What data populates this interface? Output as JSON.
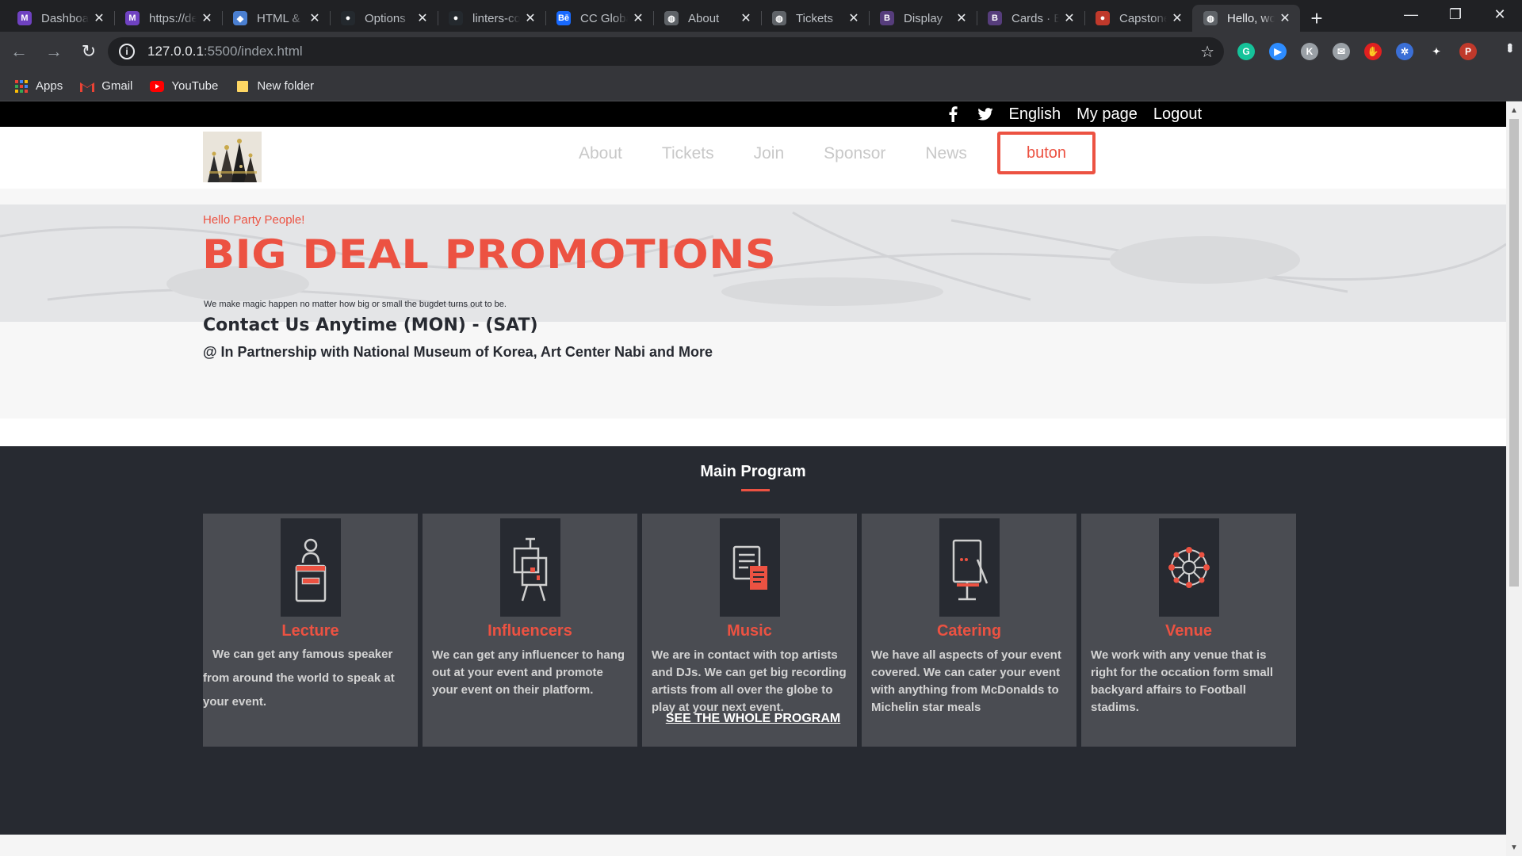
{
  "browser": {
    "tabs": [
      {
        "title": "Dashboard",
        "favicon": "app-icon",
        "color": "#6f42c1"
      },
      {
        "title": "https://dev",
        "favicon": "app-icon",
        "color": "#6f42c1"
      },
      {
        "title": "HTML & CSS",
        "favicon": "gear-icon",
        "color": "#4a7fd1"
      },
      {
        "title": "Options",
        "favicon": "github-icon",
        "color": "#24292e"
      },
      {
        "title": "linters-config",
        "favicon": "github-icon",
        "color": "#24292e"
      },
      {
        "title": "CC Global",
        "favicon": "behance-icon",
        "color": "#1769ff"
      },
      {
        "title": "About",
        "favicon": "globe-icon",
        "color": "#5f6368"
      },
      {
        "title": "Tickets",
        "favicon": "globe-icon",
        "color": "#5f6368"
      },
      {
        "title": "Display",
        "favicon": "bootstrap-icon",
        "color": "#563d7c"
      },
      {
        "title": "Cards · Bootstrap",
        "favicon": "bootstrap-icon",
        "color": "#563d7c"
      },
      {
        "title": "Capstone",
        "favicon": "circle-icon",
        "color": "#c0392b"
      },
      {
        "title": "Hello, world",
        "favicon": "globe-icon",
        "color": "#5f6368",
        "active": true
      }
    ],
    "url_host": "127.0.0.1",
    "url_rest": ":5500/index.html",
    "bookmarks": [
      {
        "label": "Apps",
        "icon": "apps-grid-icon"
      },
      {
        "label": "Gmail",
        "icon": "gmail-icon"
      },
      {
        "label": "YouTube",
        "icon": "youtube-icon"
      },
      {
        "label": "New folder",
        "icon": "folder-icon"
      }
    ],
    "extensions": [
      {
        "name": "grammarly-icon",
        "color": "#15c39a",
        "glyph": "G"
      },
      {
        "name": "zoom-icon",
        "color": "#2d8cff",
        "glyph": "▶"
      },
      {
        "name": "k-extension-icon",
        "color": "#9aa0a6",
        "glyph": "K"
      },
      {
        "name": "mail-icon",
        "color": "#9aa0a6",
        "glyph": "✉"
      },
      {
        "name": "hand-icon",
        "color": "#e02020",
        "glyph": "✋"
      },
      {
        "name": "snowflake-icon",
        "color": "#3b6fd6",
        "glyph": "✲"
      },
      {
        "name": "puzzle-icon",
        "color": "#35363a",
        "glyph": "✦"
      },
      {
        "name": "profile-avatar-icon",
        "color": "#c0392b",
        "glyph": "P"
      }
    ]
  },
  "site": {
    "topbar": {
      "links": [
        "English",
        "My page",
        "Logout"
      ],
      "social": [
        "facebook-icon",
        "twitter-icon"
      ]
    },
    "nav": {
      "links": [
        "About",
        "Tickets",
        "Join",
        "Sponsor",
        "News"
      ],
      "cta": "buton"
    },
    "hero": {
      "greeting": "Hello Party People!",
      "title": "BIG DEAL PROMOTIONS",
      "subtitle": "We make magic happen no matter how big or small the bugdet turns out to be.",
      "contact": "Contact Us Anytime (MON) - (SAT)",
      "partner": "@ In Partnership with National Museum of Korea, Art Center Nabi and More"
    },
    "program": {
      "title": "Main Program",
      "cards": [
        {
          "name": "Lecture",
          "icon": "podium-icon",
          "desc": "We can get any famous speaker from around the world to speak at your event."
        },
        {
          "name": "Influencers",
          "icon": "easel-icon",
          "desc": "We can get any influencer to hang out at your event and promote your event on their platform."
        },
        {
          "name": "Music",
          "icon": "document-icon",
          "desc": "We are in contact with top artists and DJs. We can get big recording artists from all over the globe to play at your next event."
        },
        {
          "name": "Catering",
          "icon": "presentation-icon",
          "desc": "We have all aspects of your event covered. We can cater your event with anything from McDonalds to Michelin star meals"
        },
        {
          "name": "Venue",
          "icon": "network-icon",
          "desc": "We work with any venue that is right for the occation form small backyard affairs to Football stadims."
        }
      ],
      "link": "SEE THE WHOLE PROGRAM"
    }
  }
}
